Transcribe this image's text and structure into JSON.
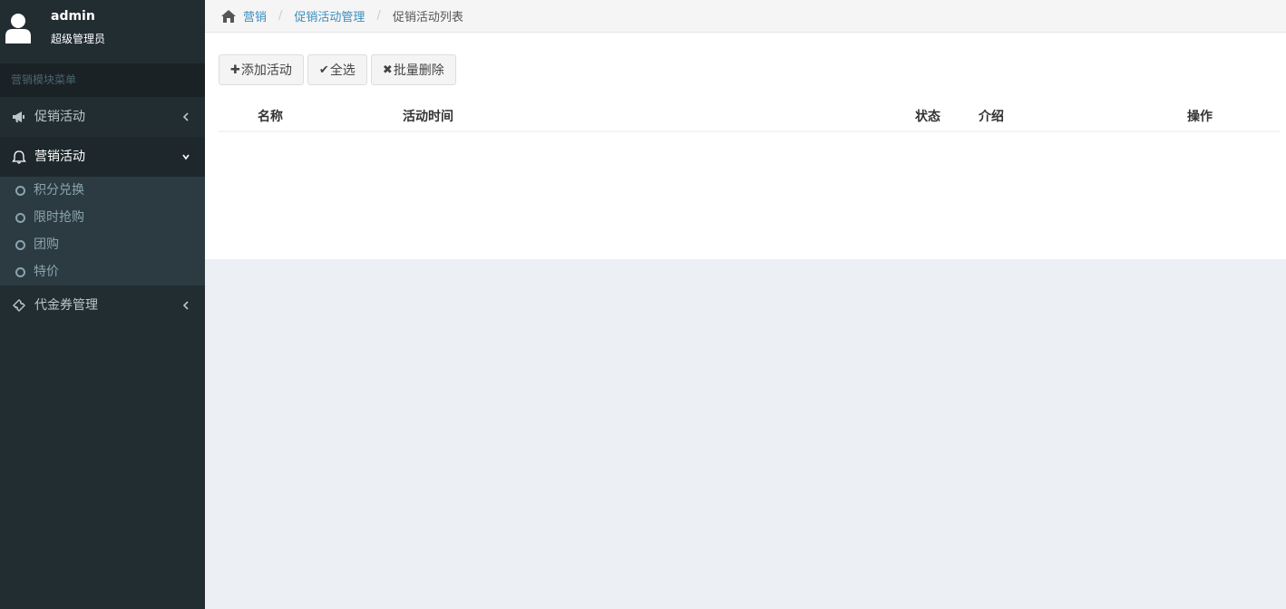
{
  "user": {
    "name": "admin",
    "role": "超级管理员"
  },
  "sidebar": {
    "header": "营销模块菜单",
    "items": [
      {
        "label": "促销活动",
        "icon": "bullhorn-icon"
      },
      {
        "label": "营销活动",
        "icon": "bell-icon"
      },
      {
        "label": "代金券管理",
        "icon": "ticket-icon"
      }
    ],
    "subitems": [
      {
        "label": "积分兑换"
      },
      {
        "label": "限时抢购"
      },
      {
        "label": "团购"
      },
      {
        "label": "特价"
      }
    ]
  },
  "breadcrumb": {
    "home": "营销",
    "section": "促销活动管理",
    "current": "促销活动列表"
  },
  "toolbar": {
    "add": "添加活动",
    "select_all": "全选",
    "batch_delete": "批量删除"
  },
  "table": {
    "columns": [
      "名称",
      "活动时间",
      "状态",
      "介绍",
      "操作"
    ]
  },
  "colors": {
    "sidebar": "#222d32",
    "accent": "#3c8dbc",
    "page_bg": "#ecf0f5"
  }
}
